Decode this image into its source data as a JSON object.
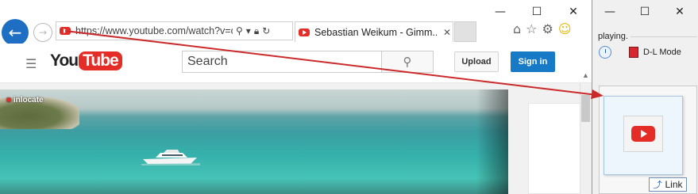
{
  "browser": {
    "window_controls": {
      "minimize": "—",
      "maximize": "☐",
      "close": "✕"
    },
    "back_glyph": "←",
    "forward_glyph": "→",
    "address_url": "https://www.youtube.com/watch?v=c",
    "tab_title": "Sebastian Weikum - Gimm...",
    "tab_close": "✕",
    "tools": {
      "home": "⌂",
      "favorites": "☆",
      "settings": "⚙",
      "feedback": "☺"
    }
  },
  "youtube": {
    "logo_you": "You",
    "logo_tube": "Tube",
    "search_placeholder": "Search",
    "upload_label": "Upload",
    "signin_label": "Sign in",
    "watermark": "inlocate"
  },
  "app_window": {
    "window_controls": {
      "minimize": "—",
      "maximize": "☐",
      "close": "✕"
    },
    "status_text": "playing.",
    "dl_mode_label": "D-L Mode",
    "link_label": "Link"
  },
  "colors": {
    "youtube_red": "#e52d27",
    "signin_blue": "#167ac6",
    "arrow_red": "#cc2a2a"
  }
}
